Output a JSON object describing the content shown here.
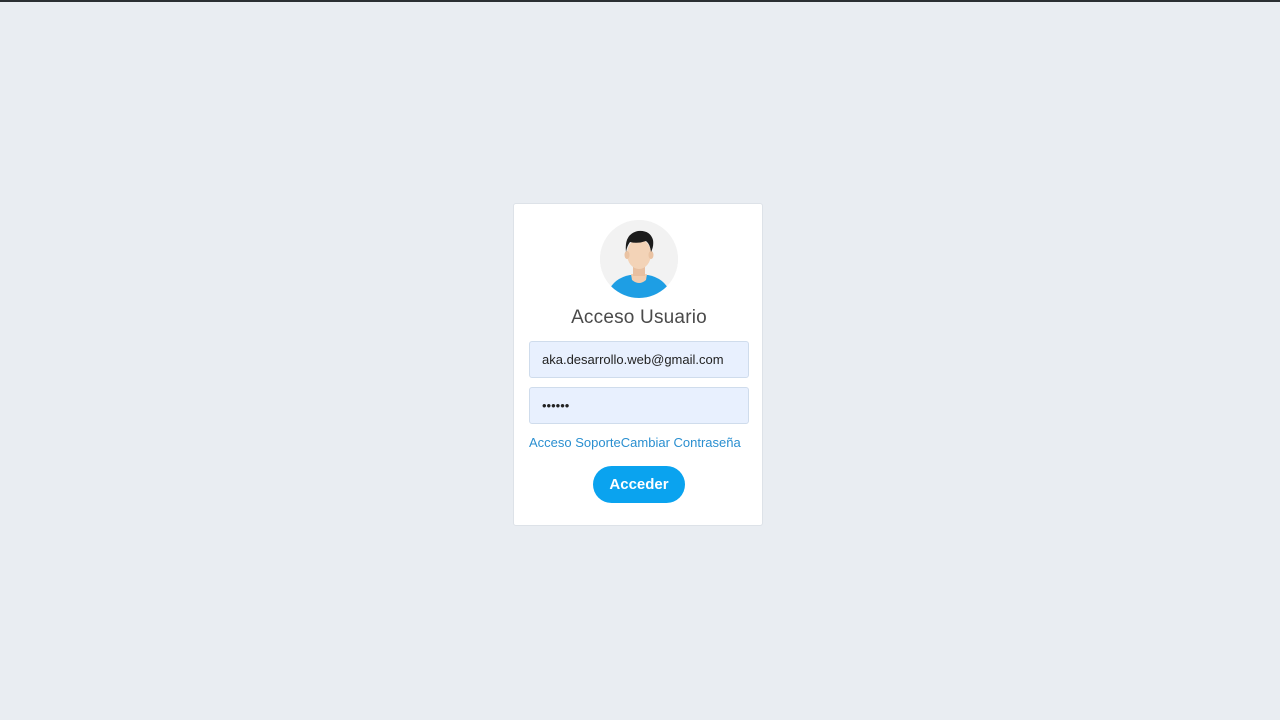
{
  "login": {
    "title": "Acceso Usuario",
    "email_value": "aka.desarrollo.web@gmail.com",
    "password_value": "••••••",
    "support_link": "Acceso Soporte",
    "change_password_link": "Cambiar Contraseña",
    "submit_label": "Acceder"
  },
  "icons": {
    "avatar": "user-avatar-icon"
  },
  "colors": {
    "background": "#e9edf2",
    "card": "#ffffff",
    "input_bg": "#e8f0fe",
    "link": "#2a8fd0",
    "button": "#0aa3ef"
  }
}
